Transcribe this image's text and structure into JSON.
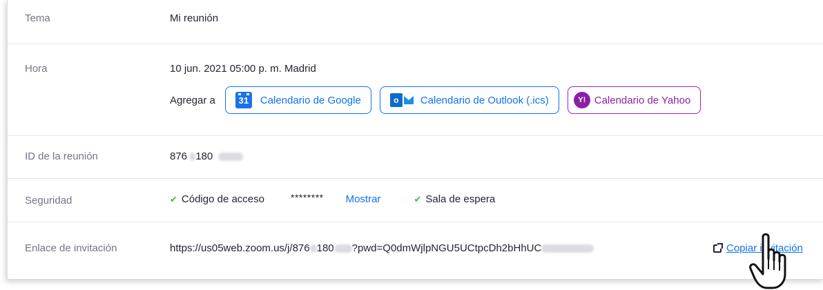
{
  "rows": {
    "topic": {
      "label": "Tema",
      "value": "Mi reunión"
    },
    "time": {
      "label": "Hora",
      "value": "10 jun. 2021 05:00 p. m. Madrid",
      "add_to_label": "Agregar a",
      "buttons": {
        "google": "Calendario de Google",
        "outlook": "Calendario de Outlook (.ics)",
        "yahoo": "Calendario de Yahoo"
      }
    },
    "meeting_id": {
      "label": "ID de la reunión",
      "part1": "876",
      "part2": "180"
    },
    "security": {
      "label": "Seguridad",
      "passcode_label": "Código de acceso",
      "passcode_mask": "********",
      "show_link": "Mostrar",
      "waiting_room": "Sala de espera"
    },
    "invite": {
      "label": "Enlace de invitación",
      "url_part1": "https://us05web.zoom.us/j/876",
      "url_part2": "180",
      "url_part3": "?pwd=Q0dmWjlpNGU5UCtpcDh2bHhUC",
      "copy_link": "Copiar invitación"
    }
  },
  "colors": {
    "accent": "#0e72ed",
    "yahoo": "#8a1fa8",
    "check": "#35c435"
  }
}
